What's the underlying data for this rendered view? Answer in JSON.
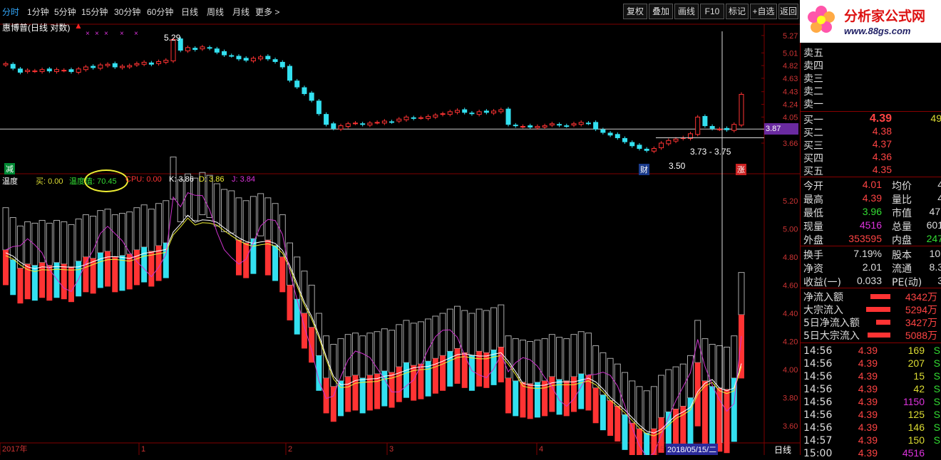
{
  "topbar": {
    "items": [
      "分时",
      "1分钟",
      "5分钟",
      "15分钟",
      "30分钟",
      "60分钟",
      "日线",
      "周线",
      "月线",
      "更多 >"
    ],
    "right": [
      "复权",
      "叠加",
      "画线",
      "F10",
      "标记",
      "+自选",
      "返回"
    ]
  },
  "stock_title": "惠博普(日线 对数)",
  "price_axis": {
    "labels": [
      "5.27",
      "5.01",
      "4.82",
      "4.63",
      "4.43",
      "4.24",
      "4.05",
      "3.87",
      "3.66"
    ],
    "current": "3.87"
  },
  "upper_annotations": {
    "high": "5.29",
    "low": "3.50",
    "range": "3.73 - 3.75",
    "cai": "财",
    "zhang": "涨"
  },
  "indicator": {
    "name": "温度",
    "buy": "买: 0.00",
    "temp": "温度值: 70.45",
    "cpu": "CPU: 0.00",
    "k": "K: 3.86",
    "d": "D: 3.86",
    "j": "J: 3.84",
    "jian": "减"
  },
  "indicator_axis": [
    "5.20",
    "5.00",
    "4.80",
    "4.60",
    "4.40",
    "4.20",
    "4.00",
    "3.80",
    "3.60"
  ],
  "x_axis": {
    "labels": [
      "2017年",
      "1",
      "2",
      "3",
      "4",
      "5"
    ],
    "date": "2018/05/15/二",
    "period": "日线"
  },
  "logo": {
    "line1": "分析家公式网",
    "line2": "www.88gs.com"
  },
  "quote": {
    "sell": [
      "卖五",
      "卖四",
      "卖三",
      "卖二",
      "卖一"
    ],
    "buy": [
      {
        "k": "买一",
        "p": "4.39",
        "v": "49"
      },
      {
        "k": "买二",
        "p": "4.38"
      },
      {
        "k": "买三",
        "p": "4.37"
      },
      {
        "k": "买四",
        "p": "4.36"
      },
      {
        "k": "买五",
        "p": "4.35"
      }
    ],
    "stats": [
      {
        "k": "今开",
        "v": "4.01",
        "k2": "均价",
        "v2": "4"
      },
      {
        "k": "最高",
        "v": "4.39",
        "k2": "量比",
        "v2": "4"
      },
      {
        "k": "最低",
        "v": "3.96",
        "k2": "市值",
        "v2": "47."
      },
      {
        "k": "现量",
        "v": "4516",
        "k2": "总量",
        "v2": "601"
      },
      {
        "k": "外盘",
        "v": "353595",
        "k2": "内盘",
        "v2": "247"
      }
    ],
    "stats2": [
      {
        "k": "换手",
        "v": "7.19%",
        "k2": "股本",
        "v2": "10."
      },
      {
        "k": "净资",
        "v": "2.01",
        "k2": "流通",
        "v2": "8.3"
      },
      {
        "k": "收益(一)",
        "v": "0.033",
        "k2": "PE(动)",
        "v2": "3"
      }
    ],
    "flows": [
      {
        "k": "净流入额",
        "v": "4342万",
        "w": 28
      },
      {
        "k": "大宗流入",
        "v": "5294万",
        "w": 34
      },
      {
        "k": "5日净流入额",
        "v": "3427万",
        "w": 20
      },
      {
        "k": "5日大宗流入",
        "v": "5088万",
        "w": 32
      }
    ],
    "ticks": [
      {
        "t": "14:56",
        "p": "4.39",
        "v": "169",
        "s": "S"
      },
      {
        "t": "14:56",
        "p": "4.39",
        "v": "207",
        "s": "S"
      },
      {
        "t": "14:56",
        "p": "4.39",
        "v": "15",
        "s": "S"
      },
      {
        "t": "14:56",
        "p": "4.39",
        "v": "42",
        "s": "S"
      },
      {
        "t": "14:56",
        "p": "4.39",
        "v": "1150",
        "s": "S"
      },
      {
        "t": "14:56",
        "p": "4.39",
        "v": "125",
        "s": "S"
      },
      {
        "t": "14:56",
        "p": "4.39",
        "v": "146",
        "s": "S"
      },
      {
        "t": "14:57",
        "p": "4.39",
        "v": "150",
        "s": "S"
      },
      {
        "t": "15:00",
        "p": "4.39",
        "v": "4516",
        "s": ""
      }
    ]
  },
  "colors": {
    "up": "#ff3333",
    "down": "#33e0f0",
    "bg": "#000000",
    "grid": "#800000"
  },
  "chart_data": {
    "type": "candlestick",
    "closes": [
      4.85,
      4.78,
      4.72,
      4.75,
      4.74,
      4.76,
      4.74,
      4.76,
      4.75,
      4.73,
      4.77,
      4.8,
      4.79,
      4.83,
      4.84,
      4.8,
      4.81,
      4.82,
      4.85,
      4.87,
      4.84,
      4.88,
      4.9,
      5.21,
      5.05,
      5.09,
      5.06,
      5.1,
      5.08,
      5.02,
      4.98,
      4.97,
      4.92,
      4.9,
      4.93,
      4.95,
      4.92,
      4.88,
      4.8,
      4.6,
      4.5,
      4.4,
      4.3,
      4.1,
      3.94,
      3.88,
      3.92,
      3.95,
      3.96,
      3.94,
      3.96,
      3.97,
      3.99,
      3.98,
      4.02,
      4.05,
      4.03,
      4.04,
      4.06,
      4.08,
      4.1,
      4.13,
      4.15,
      4.12,
      4.1,
      4.13,
      4.12,
      4.14,
      4.16,
      3.94,
      3.92,
      3.91,
      3.9,
      3.91,
      3.92,
      3.95,
      3.93,
      3.92,
      3.95,
      3.97,
      3.96,
      3.87,
      3.82,
      3.78,
      3.74,
      3.68,
      3.62,
      3.58,
      3.55,
      3.58,
      3.66,
      3.7,
      3.72,
      3.74,
      3.8,
      4.05,
      3.92,
      3.88,
      3.87,
      3.86,
      3.94,
      4.39
    ]
  }
}
